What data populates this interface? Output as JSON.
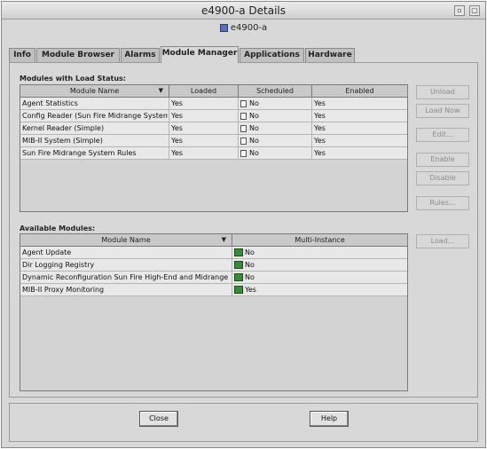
{
  "window": {
    "title": "e4900-a Details",
    "host_name": "e4900-a"
  },
  "tabs": [
    {
      "label": "Info"
    },
    {
      "label": "Module Browser"
    },
    {
      "label": "Alarms"
    },
    {
      "label": "Module Manager",
      "active": true
    },
    {
      "label": "Applications"
    },
    {
      "label": "Hardware"
    }
  ],
  "loaded_modules": {
    "label": "Modules with Load Status:",
    "columns": [
      "Module Name",
      "Loaded",
      "Scheduled",
      "Enabled"
    ],
    "rows": [
      {
        "name": "Agent Statistics",
        "loaded": "Yes",
        "scheduled": "No",
        "enabled": "Yes"
      },
      {
        "name": "Config Reader (Sun Fire Midrange Systems)",
        "loaded": "Yes",
        "scheduled": "No",
        "enabled": "Yes"
      },
      {
        "name": "Kernel Reader (Simple)",
        "loaded": "Yes",
        "scheduled": "No",
        "enabled": "Yes"
      },
      {
        "name": "MIB-II System (Simple)",
        "loaded": "Yes",
        "scheduled": "No",
        "enabled": "Yes"
      },
      {
        "name": "Sun Fire Midrange System Rules",
        "loaded": "Yes",
        "scheduled": "No",
        "enabled": "Yes"
      }
    ]
  },
  "available_modules": {
    "label": "Available Modules:",
    "columns": [
      "Module Name",
      "Multi-Instance"
    ],
    "rows": [
      {
        "name": "Agent Update",
        "multi": "No"
      },
      {
        "name": "Dir Logging Registry",
        "multi": "No"
      },
      {
        "name": "Dynamic Reconfiguration Sun Fire High-End and Midrange Sys...",
        "multi": "No"
      },
      {
        "name": "MIB-II Proxy Monitoring",
        "multi": "Yes"
      }
    ]
  },
  "side_buttons": {
    "unload": "Unload",
    "load_now": "Load Now",
    "edit": "Edit...",
    "enable": "Enable",
    "disable": "Disable",
    "rules": "Rules...",
    "load": "Load..."
  },
  "footer": {
    "close": "Close",
    "help": "Help"
  }
}
